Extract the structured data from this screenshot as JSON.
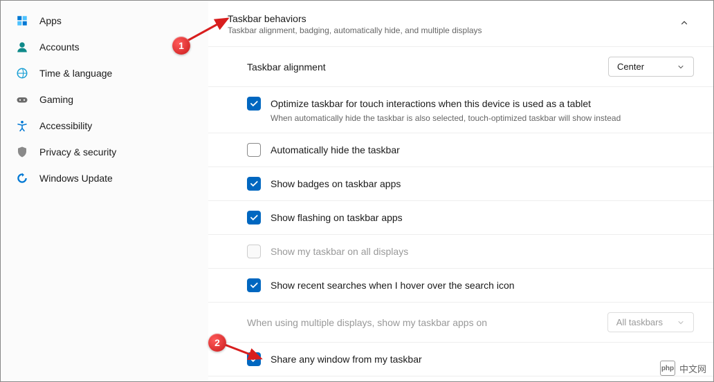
{
  "sidebar": {
    "items": [
      {
        "label": "Apps"
      },
      {
        "label": "Accounts"
      },
      {
        "label": "Time & language"
      },
      {
        "label": "Gaming"
      },
      {
        "label": "Accessibility"
      },
      {
        "label": "Privacy & security"
      },
      {
        "label": "Windows Update"
      }
    ]
  },
  "header": {
    "title": "Taskbar behaviors",
    "subtitle": "Taskbar alignment, badging, automatically hide, and multiple displays"
  },
  "alignment": {
    "label": "Taskbar alignment",
    "value": "Center"
  },
  "opts": {
    "touch": {
      "label": "Optimize taskbar for touch interactions when this device is used as a tablet",
      "sub": "When automatically hide the taskbar is also selected, touch-optimized taskbar will show instead",
      "checked": true
    },
    "autohide": {
      "label": "Automatically hide the taskbar",
      "checked": false
    },
    "badges": {
      "label": "Show badges on taskbar apps",
      "checked": true
    },
    "flashing": {
      "label": "Show flashing on taskbar apps",
      "checked": true
    },
    "alldisplays": {
      "label": "Show my taskbar on all displays",
      "checked": false,
      "disabled": true
    },
    "recent": {
      "label": "Show recent searches when I hover over the search icon",
      "checked": true
    },
    "multidisplay": {
      "label": "When using multiple displays, show my taskbar apps on",
      "value": "All taskbars",
      "disabled": true
    },
    "share": {
      "label": "Share any window from my taskbar",
      "checked": true
    }
  },
  "callouts": {
    "one": "1",
    "two": "2"
  },
  "watermark": {
    "logo": "php",
    "text": "中文网"
  }
}
